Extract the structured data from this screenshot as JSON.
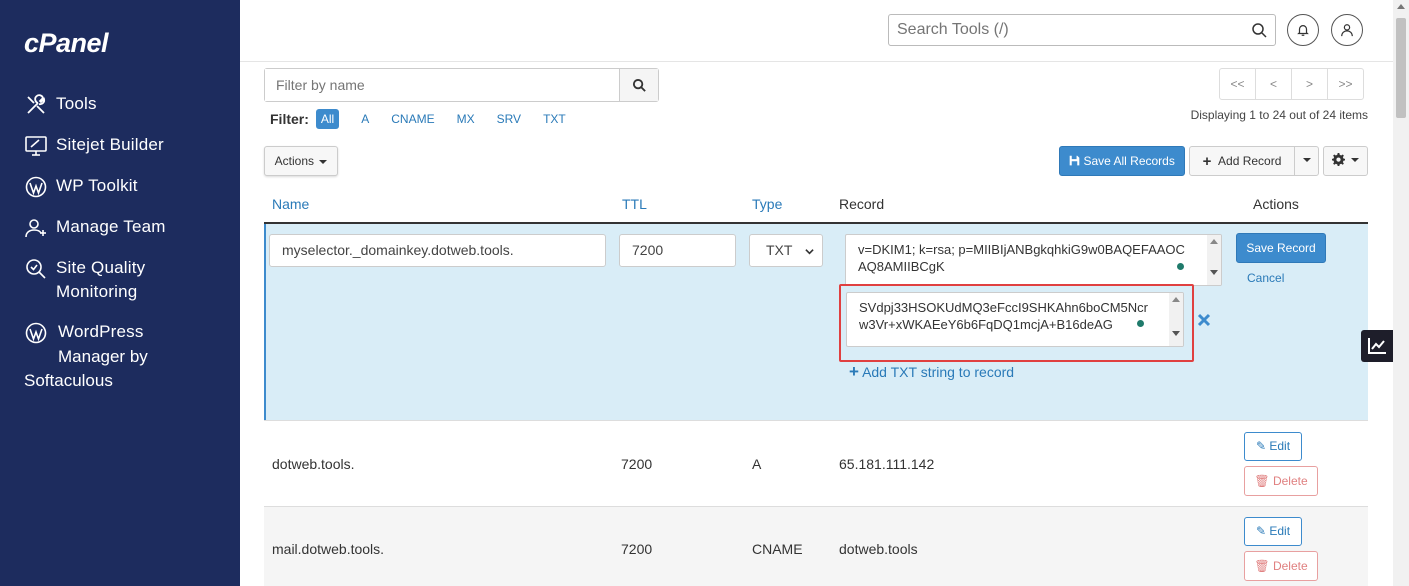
{
  "sidebar": {
    "logo": "cPanel",
    "items": [
      {
        "label": "Tools",
        "icon": "tools-icon"
      },
      {
        "label": "Sitejet Builder",
        "icon": "sitejet-icon"
      },
      {
        "label": "WP Toolkit",
        "icon": "wordpress-icon"
      },
      {
        "label": "Manage Team",
        "icon": "team-icon"
      },
      {
        "label": "Site Quality",
        "label2": "Monitoring",
        "icon": "site-quality-icon"
      },
      {
        "label": "WordPress",
        "label2": "Manager by",
        "label3": "Softaculous",
        "icon": "wordpress-icon"
      }
    ]
  },
  "header": {
    "search_placeholder": "Search Tools (/)"
  },
  "toolbar": {
    "filter_placeholder": "Filter by name",
    "filter_label": "Filter:",
    "filter_options": [
      "All",
      "A",
      "CNAME",
      "MX",
      "SRV",
      "TXT"
    ],
    "active_filter": "All",
    "pager": [
      "<<",
      "<",
      ">",
      ">>"
    ],
    "displaying": "Displaying 1 to 24 out of 24 items",
    "actions_label": "Actions",
    "save_all_label": "Save All Records",
    "add_record_label": "Add Record"
  },
  "table": {
    "headers": {
      "name": "Name",
      "ttl": "TTL",
      "type": "Type",
      "record": "Record",
      "actions": "Actions"
    },
    "edit_row": {
      "name": "myselector._domainkey.dotweb.tools.",
      "ttl": "7200",
      "type": "TXT",
      "record_1": "v=DKIM1; k=rsa; p=MIIBIjANBgkqhkiG9w0BAQEFAAOCAQ8AMIIBCgK",
      "record_2": "SVdpj33HSOKUdMQ3eFccI9SHKAhn6boCM5Ncrw3Vr+xWKAEeY6b6FqDQ1mcjA+B16deAG",
      "save_label": "Save Record",
      "cancel_label": "Cancel",
      "add_txt_label": "Add TXT string to record"
    },
    "rows": [
      {
        "name": "dotweb.tools.",
        "ttl": "7200",
        "type": "A",
        "record": "65.181.111.142",
        "edit": "Edit",
        "delete": "Delete"
      },
      {
        "name": "mail.dotweb.tools.",
        "ttl": "7200",
        "type": "CNAME",
        "record": "dotweb.tools",
        "edit": "Edit",
        "delete": "Delete"
      }
    ]
  }
}
